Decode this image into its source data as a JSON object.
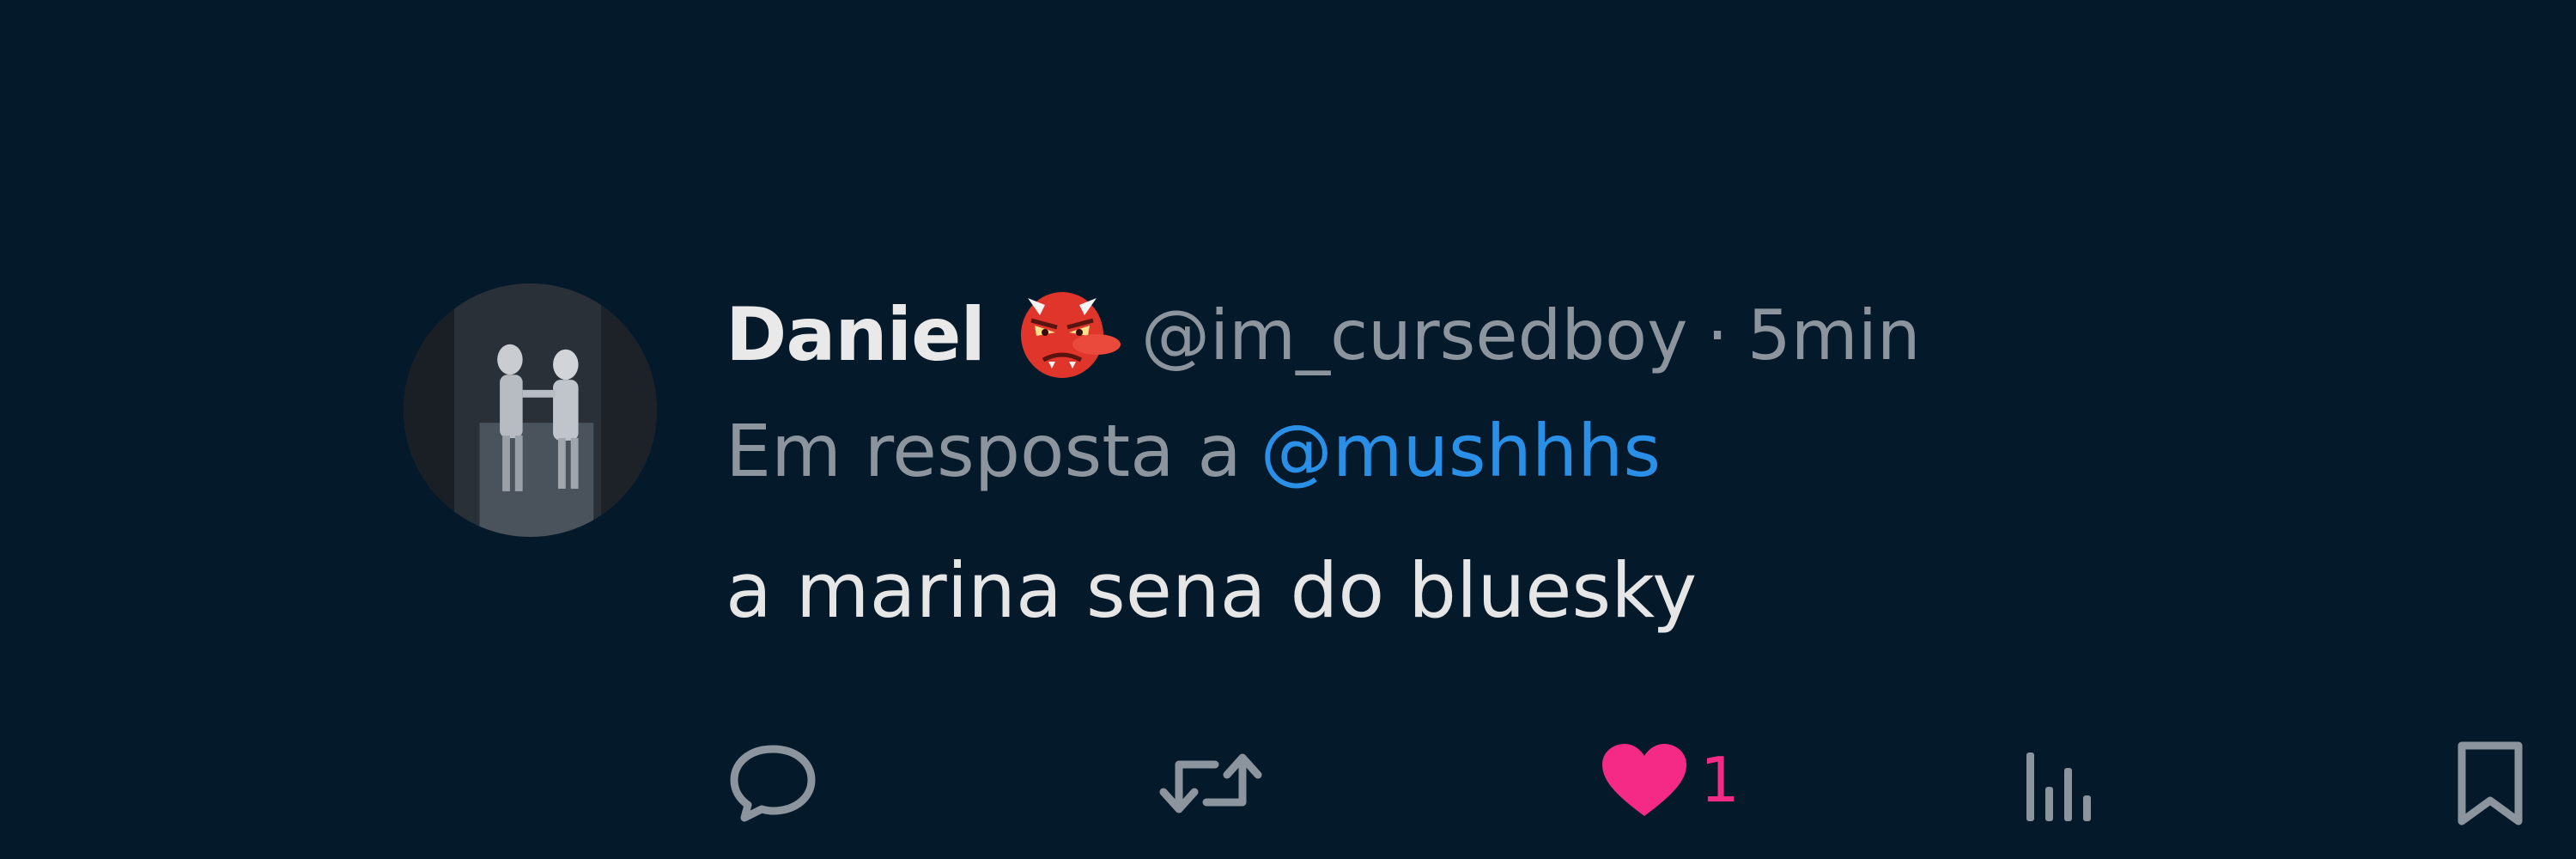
{
  "tweet": {
    "display_name": "Daniel",
    "name_emoji": "goblin-mask-icon",
    "handle": "@im_cursedboy",
    "separator": "·",
    "time": "5min",
    "reply_prefix": "Em resposta a",
    "reply_to": "@mushhhs",
    "text": "a marina sena do bluesky"
  },
  "actions": {
    "reply_icon": "speech-bubble-icon",
    "retweet_icon": "retweet-icon",
    "like_icon": "heart-icon",
    "like_count": "1",
    "views_icon": "bar-chart-icon",
    "bookmark_icon": "bookmark-icon"
  },
  "colors": {
    "background": "#04192a",
    "muted_text": "#8c959e",
    "mention": "#2a8fe6",
    "like": "#f52a86",
    "icon": "#8c959e"
  }
}
